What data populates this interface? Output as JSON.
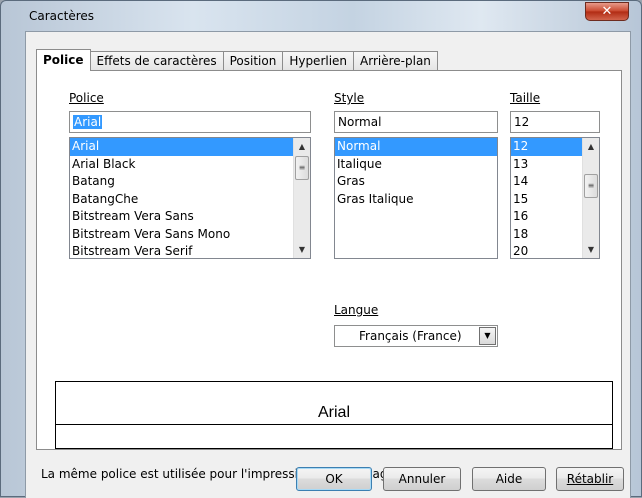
{
  "window": {
    "title": "Caractères",
    "close_glyph": "✕"
  },
  "tabs": [
    {
      "label": "Police",
      "active": true
    },
    {
      "label": "Effets de caractères",
      "active": false
    },
    {
      "label": "Position",
      "active": false
    },
    {
      "label": "Hyperlien",
      "active": false
    },
    {
      "label": "Arrière-plan",
      "active": false
    }
  ],
  "font": {
    "label": "Police",
    "value": "Arial",
    "items": [
      "Arial",
      "Arial Black",
      "Batang",
      "BatangChe",
      "Bitstream Vera Sans",
      "Bitstream Vera Sans Mono",
      "Bitstream Vera Serif"
    ],
    "selected_index": 0
  },
  "style": {
    "label": "Style",
    "value": "Normal",
    "items": [
      "Normal",
      "Italique",
      "Gras",
      "Gras Italique"
    ],
    "selected_index": 0
  },
  "size": {
    "label": "Taille",
    "value": "12",
    "items": [
      "12",
      "13",
      "14",
      "15",
      "16",
      "18",
      "20"
    ],
    "selected_index": 0
  },
  "language": {
    "label": "Langue",
    "value": "Français (France)"
  },
  "preview": {
    "text": "Arial"
  },
  "info_text": "La même police est utilisée pour l'impression et l'affichage à l'écran.",
  "buttons": {
    "ok": "OK",
    "cancel": "Annuler",
    "help": "Aide",
    "reset": "Rétablir"
  },
  "colors": {
    "selection": "#3399ff",
    "close_button": "#c8452b"
  },
  "icons": {
    "scroll_up": "▲",
    "scroll_down": "▼",
    "grip": "≡",
    "dropdown": "▼"
  }
}
